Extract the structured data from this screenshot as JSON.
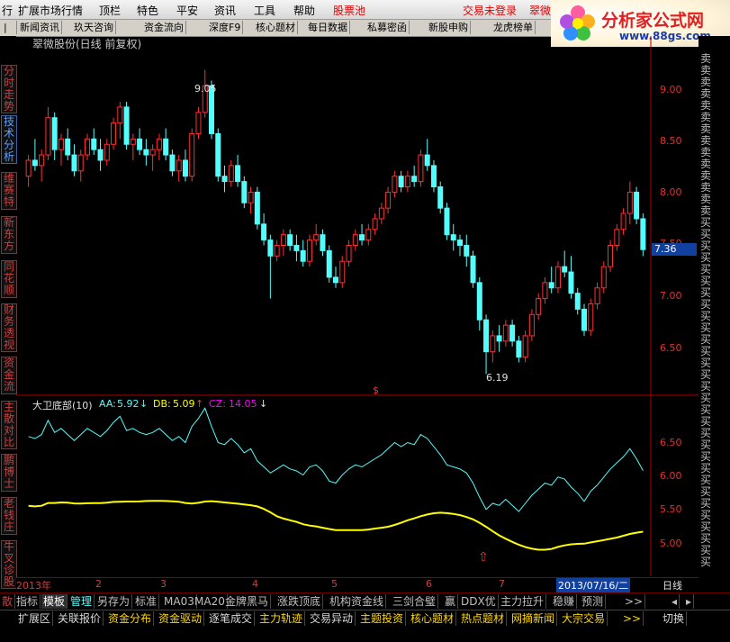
{
  "menu": {
    "items": [
      "行",
      "扩展市场行情",
      "顶栏",
      "特色",
      "平安",
      "资讯",
      "工具",
      "帮助"
    ],
    "special": "股票池",
    "trade": "交易未登录",
    "trade2": "翠微"
  },
  "toolbar": {
    "items": [
      "新闻资讯",
      "玖天咨询",
      "资金流向",
      "深度F9",
      "核心题材",
      "每日数据",
      "私募密函",
      "新股申购",
      "龙虎榜单"
    ]
  },
  "logo": {
    "title": "分析家公式网",
    "url": "www.88gs.com"
  },
  "sidebar": {
    "items": [
      "分时走势",
      "技术分析",
      "维赛特",
      "新东方",
      "同花顺",
      "财务透视",
      "资金流",
      "主散对比",
      "鹏博士",
      "老钱庄",
      "牛叉诊股"
    ]
  },
  "chart_title": "翠微股份(日线 前复权)",
  "price_axis": {
    "ticks": [
      "9.00",
      "8.50",
      "8.00",
      "7.50",
      "7.00",
      "6.50"
    ],
    "current": "7.36"
  },
  "annotations": {
    "high": "9.05",
    "low": "6.19"
  },
  "indicator": {
    "name": "大卫底部(10)",
    "aa_label": "AA:",
    "aa_value": "5.92",
    "db_label": "DB:",
    "db_value": "5.09",
    "cz_label": "CZ:",
    "cz_value": "14.05",
    "ticks": [
      "6.50",
      "6.00",
      "5.50",
      "5.00"
    ]
  },
  "right_col_label": "买",
  "right_col_labels_sell": "卖",
  "dates": {
    "year": "2013年",
    "months": [
      "2",
      "3",
      "4",
      "5",
      "6",
      "7"
    ],
    "cursor_date": "2013/07/16/二",
    "period": "日线"
  },
  "bottom_tabs": [
    "指标",
    "模板",
    "管理",
    "另存为",
    "标准",
    "MA03",
    "MA20",
    "金牌黑马",
    "涨跌顶底",
    "机构资金线",
    "三剑合璧",
    "赢",
    "DDX优",
    "主力拉升",
    "稳赚",
    "预测",
    ">>"
  ],
  "bottom_tabs_left": "散",
  "bottom2": [
    "扩展区",
    "关联报价",
    "资金分布",
    "资金驱动",
    "逐笔成交",
    "主力轨迹",
    "交易异动",
    "主题投资",
    "核心题材",
    "热点题材",
    "网摘新闻",
    "大宗交易",
    ">>",
    "切换"
  ],
  "colors": {
    "up": "#ff3030",
    "down": "#54fcfc",
    "aa": "#54fcfc",
    "db": "#ffff00",
    "cz": "#ff00ff",
    "axis": "#b00000"
  },
  "chart_data": {
    "type": "candlestick",
    "title": "翠微股份(日线 前复权)",
    "y_range": [
      6.05,
      9.3
    ],
    "candles": [
      [
        8.05,
        8.25,
        7.95,
        8.2
      ],
      [
        8.2,
        8.4,
        8.1,
        8.15
      ],
      [
        8.15,
        8.3,
        8.0,
        8.25
      ],
      [
        8.25,
        8.7,
        8.2,
        8.6
      ],
      [
        8.6,
        8.65,
        8.2,
        8.3
      ],
      [
        8.3,
        8.45,
        8.15,
        8.4
      ],
      [
        8.4,
        8.5,
        8.2,
        8.25
      ],
      [
        8.25,
        8.35,
        8.05,
        8.1
      ],
      [
        8.1,
        8.3,
        8.0,
        8.25
      ],
      [
        8.25,
        8.45,
        8.2,
        8.4
      ],
      [
        8.4,
        8.5,
        8.25,
        8.3
      ],
      [
        8.3,
        8.4,
        8.1,
        8.2
      ],
      [
        8.2,
        8.4,
        8.15,
        8.35
      ],
      [
        8.35,
        8.6,
        8.3,
        8.55
      ],
      [
        8.55,
        8.75,
        8.4,
        8.7
      ],
      [
        8.7,
        8.75,
        8.3,
        8.35
      ],
      [
        8.35,
        8.45,
        8.2,
        8.4
      ],
      [
        8.4,
        8.5,
        8.25,
        8.3
      ],
      [
        8.3,
        8.4,
        8.15,
        8.25
      ],
      [
        8.25,
        8.35,
        8.1,
        8.3
      ],
      [
        8.3,
        8.45,
        8.2,
        8.4
      ],
      [
        8.4,
        8.5,
        8.2,
        8.25
      ],
      [
        8.25,
        8.3,
        8.05,
        8.1
      ],
      [
        8.1,
        8.25,
        8.0,
        8.2
      ],
      [
        8.2,
        8.3,
        8.0,
        8.05
      ],
      [
        8.05,
        8.5,
        8.0,
        8.45
      ],
      [
        8.45,
        8.7,
        8.4,
        8.65
      ],
      [
        8.65,
        9.05,
        8.6,
        8.9
      ],
      [
        8.9,
        8.95,
        8.4,
        8.45
      ],
      [
        8.45,
        8.5,
        8.0,
        8.05
      ],
      [
        8.05,
        8.15,
        7.9,
        8.0
      ],
      [
        8.0,
        8.2,
        7.95,
        8.15
      ],
      [
        8.15,
        8.25,
        7.95,
        8.0
      ],
      [
        8.0,
        8.05,
        7.75,
        7.8
      ],
      [
        7.8,
        7.95,
        7.7,
        7.9
      ],
      [
        7.9,
        7.95,
        7.55,
        7.6
      ],
      [
        7.6,
        7.7,
        7.4,
        7.45
      ],
      [
        7.45,
        7.5,
        6.9,
        7.3
      ],
      [
        7.3,
        7.45,
        7.25,
        7.4
      ],
      [
        7.4,
        7.55,
        7.3,
        7.5
      ],
      [
        7.5,
        7.55,
        7.35,
        7.4
      ],
      [
        7.4,
        7.5,
        7.25,
        7.35
      ],
      [
        7.35,
        7.45,
        7.2,
        7.25
      ],
      [
        7.25,
        7.5,
        7.2,
        7.45
      ],
      [
        7.45,
        7.6,
        7.4,
        7.5
      ],
      [
        7.5,
        7.55,
        7.3,
        7.35
      ],
      [
        7.35,
        7.4,
        7.05,
        7.1
      ],
      [
        7.1,
        7.2,
        7.0,
        7.05
      ],
      [
        7.05,
        7.3,
        7.0,
        7.25
      ],
      [
        7.25,
        7.45,
        7.2,
        7.4
      ],
      [
        7.4,
        7.55,
        7.35,
        7.5
      ],
      [
        7.5,
        7.6,
        7.4,
        7.45
      ],
      [
        7.45,
        7.6,
        7.4,
        7.55
      ],
      [
        7.55,
        7.7,
        7.5,
        7.65
      ],
      [
        7.65,
        7.8,
        7.6,
        7.75
      ],
      [
        7.75,
        7.95,
        7.7,
        7.9
      ],
      [
        7.9,
        8.1,
        7.85,
        8.05
      ],
      [
        8.05,
        8.1,
        7.9,
        7.95
      ],
      [
        7.95,
        8.1,
        7.9,
        8.05
      ],
      [
        8.05,
        8.15,
        7.95,
        8.0
      ],
      [
        8.0,
        8.3,
        7.95,
        8.25
      ],
      [
        8.25,
        8.4,
        8.1,
        8.15
      ],
      [
        8.15,
        8.2,
        7.9,
        7.95
      ],
      [
        7.95,
        8.0,
        7.7,
        7.75
      ],
      [
        7.75,
        7.8,
        7.45,
        7.5
      ],
      [
        7.5,
        7.6,
        7.35,
        7.45
      ],
      [
        7.45,
        7.5,
        7.3,
        7.4
      ],
      [
        7.4,
        7.5,
        7.2,
        7.3
      ],
      [
        7.3,
        7.35,
        7.0,
        7.05
      ],
      [
        7.05,
        7.1,
        6.6,
        6.7
      ],
      [
        6.7,
        6.75,
        6.19,
        6.4
      ],
      [
        6.4,
        6.6,
        6.3,
        6.55
      ],
      [
        6.55,
        6.65,
        6.4,
        6.5
      ],
      [
        6.5,
        6.7,
        6.45,
        6.65
      ],
      [
        6.65,
        6.7,
        6.45,
        6.5
      ],
      [
        6.5,
        6.55,
        6.3,
        6.35
      ],
      [
        6.35,
        6.6,
        6.3,
        6.55
      ],
      [
        6.55,
        6.8,
        6.5,
        6.75
      ],
      [
        6.75,
        6.95,
        6.7,
        6.9
      ],
      [
        6.9,
        7.1,
        6.85,
        7.05
      ],
      [
        7.05,
        7.2,
        6.95,
        7.0
      ],
      [
        7.0,
        7.25,
        6.95,
        7.2
      ],
      [
        7.2,
        7.35,
        7.1,
        7.15
      ],
      [
        7.15,
        7.3,
        6.9,
        6.95
      ],
      [
        6.95,
        7.0,
        6.75,
        6.8
      ],
      [
        6.8,
        6.85,
        6.55,
        6.6
      ],
      [
        6.6,
        6.9,
        6.55,
        6.85
      ],
      [
        6.85,
        7.05,
        6.8,
        7.0
      ],
      [
        7.0,
        7.25,
        6.95,
        7.2
      ],
      [
        7.2,
        7.45,
        7.15,
        7.4
      ],
      [
        7.4,
        7.6,
        7.35,
        7.55
      ],
      [
        7.55,
        7.75,
        7.5,
        7.7
      ],
      [
        7.7,
        8.0,
        7.6,
        7.9
      ],
      [
        7.9,
        7.95,
        7.6,
        7.65
      ],
      [
        7.65,
        7.7,
        7.3,
        7.36
      ]
    ],
    "indicator_series": [
      {
        "name": "AA",
        "range": [
          4.75,
          7.0
        ]
      },
      {
        "name": "DB",
        "range": [
          4.75,
          7.0
        ]
      }
    ]
  }
}
